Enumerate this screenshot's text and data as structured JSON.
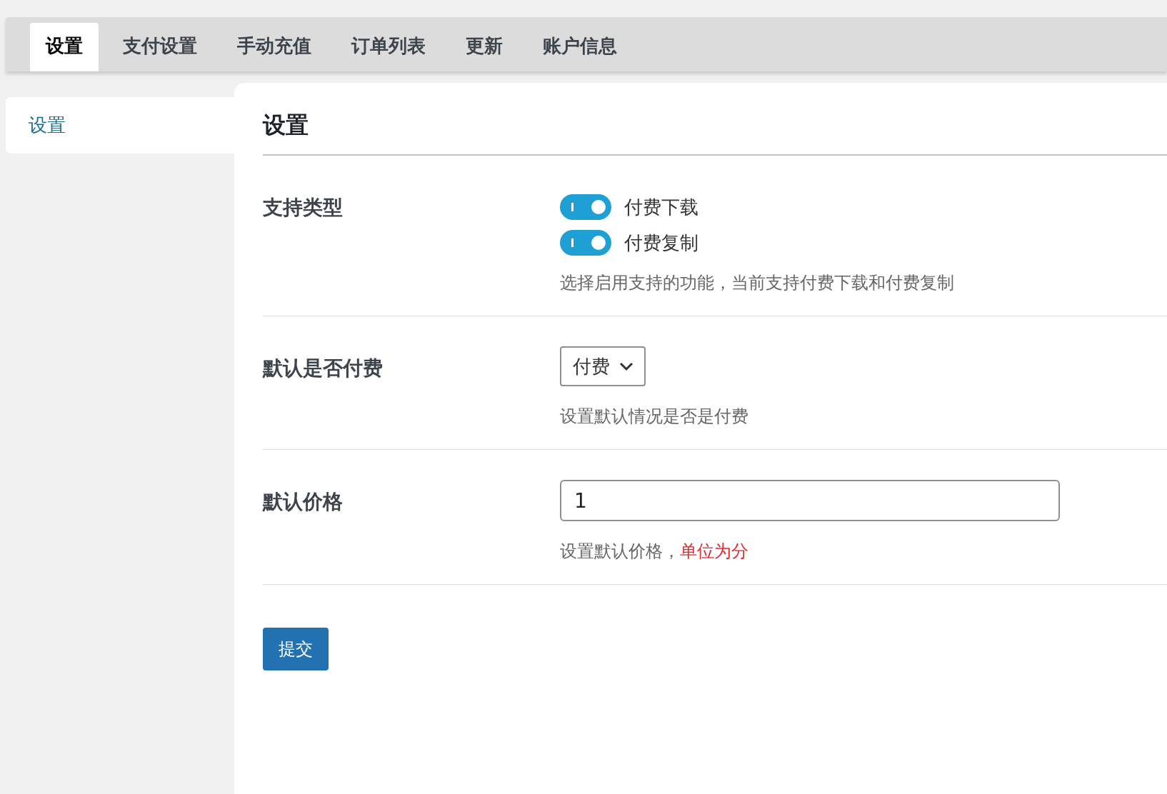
{
  "tabs": [
    {
      "label": "设置",
      "selected": true
    },
    {
      "label": "支付设置",
      "selected": false
    },
    {
      "label": "手动充值",
      "selected": false
    },
    {
      "label": "订单列表",
      "selected": false
    },
    {
      "label": "更新",
      "selected": false
    },
    {
      "label": "账户信息",
      "selected": false
    }
  ],
  "sidebar": {
    "items": [
      {
        "label": "设置",
        "selected": true
      }
    ]
  },
  "panel": {
    "title": "设置",
    "rows": [
      {
        "kind": "toggles",
        "label": "支持类型",
        "toggles": [
          {
            "label": "付费下载",
            "on": true
          },
          {
            "label": "付费复制",
            "on": true
          }
        ],
        "help": [
          {
            "kind": "normal",
            "text": "选择启用支持的功能，当前支持付费下载和付费复制"
          }
        ]
      },
      {
        "kind": "select",
        "label": "默认是否付费",
        "value": "付费",
        "help": [
          {
            "kind": "normal",
            "text": "设置默认情况是否是付费"
          }
        ]
      },
      {
        "kind": "input",
        "label": "默认价格",
        "value": "1",
        "help": [
          {
            "kind": "normal",
            "text": "设置默认价格，"
          },
          {
            "kind": "warning",
            "text": "单位为分"
          }
        ]
      }
    ],
    "submit": "提交"
  }
}
